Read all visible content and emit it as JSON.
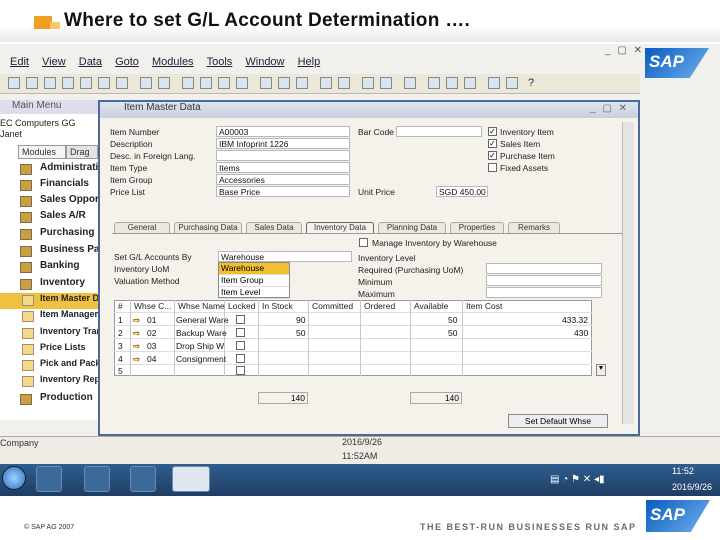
{
  "slide": {
    "title": "Where to set G/L Account Determination ….",
    "copyright": "© SAP AG 2007",
    "tagline": "THE BEST-RUN BUSINESSES RUN SAP",
    "logo_text": "SAP",
    "accent_color": "#f0a020"
  },
  "menubar": [
    "Edit",
    "View",
    "Data",
    "Goto",
    "Modules",
    "Tools",
    "Window",
    "Help"
  ],
  "main_menu": {
    "title": "Main Menu",
    "company": [
      "EC Computers GG",
      "Janet"
    ],
    "tabs": [
      "Modules",
      "Drag"
    ],
    "items": [
      "Administration",
      "Financials",
      "Sales Opportunities",
      "Sales A/R",
      "Purchasing",
      "Business Partners",
      "Banking",
      "Inventory"
    ],
    "sub_items": [
      "Item Master Data",
      "Item Management",
      "Inventory Transactions",
      "Price Lists",
      "Pick and Pack",
      "Inventory Reports",
      "Production"
    ]
  },
  "item_master": {
    "title": "Item Master Data",
    "fields": {
      "item_number_label": "Item Number",
      "item_number": "A00003",
      "description_label": "Description",
      "description": "IBM Infoprint 1226",
      "foreign_label": "Desc. in Foreign Lang.",
      "item_type_label": "Item Type",
      "item_type": "Items",
      "item_group_label": "Item Group",
      "item_group": "Accessories",
      "price_list_label": "Price List",
      "price_list": "Base Price",
      "bar_code_label": "Bar Code",
      "unit_price_label": "Unit Price",
      "unit_price": "SGD 450.00"
    },
    "checkboxes": [
      {
        "label": "Inventory Item",
        "checked": true
      },
      {
        "label": "Sales Item",
        "checked": true
      },
      {
        "label": "Purchase Item",
        "checked": true
      },
      {
        "label": "Fixed Assets",
        "checked": false
      }
    ],
    "tabs": [
      "General",
      "Purchasing Data",
      "Sales Data",
      "Inventory Data",
      "Planning Data",
      "Properties",
      "Remarks"
    ],
    "active_tab": "Inventory Data",
    "manage_by_wh": "Manage Inventory by Warehouse",
    "set_gl_label": "Set G/L Accounts By",
    "set_gl_value": "Warehouse",
    "uom_label": "Inventory UoM",
    "valuation_label": "Valuation Method",
    "dropdown_options": [
      "Warehouse",
      "Item Group",
      "Item Level"
    ],
    "levels": [
      "Inventory Level",
      "Required (Purchasing UoM)",
      "Minimum",
      "Maximum"
    ],
    "grid_headers": [
      "#",
      "Whse C...",
      "Whse Name",
      "Locked",
      "In Stock",
      "Committed",
      "Ordered",
      "Available",
      "Item Cost"
    ],
    "rows": [
      {
        "n": "1",
        "code": "01",
        "name": "General Ware",
        "stock": "90",
        "available": "50",
        "cost": "433.32"
      },
      {
        "n": "2",
        "code": "02",
        "name": "Backup Ware",
        "stock": "50",
        "available": "50",
        "cost": "430"
      },
      {
        "n": "3",
        "code": "03",
        "name": "Drop Ship W",
        "stock": "",
        "available": "",
        "cost": ""
      },
      {
        "n": "4",
        "code": "04",
        "name": "Consignment",
        "stock": "",
        "available": "",
        "cost": ""
      },
      {
        "n": "5",
        "code": "",
        "name": "",
        "stock": "",
        "available": "",
        "cost": ""
      }
    ],
    "total_stock": "140",
    "total_available": "140",
    "set_default_button": "Set Default Whse"
  },
  "status": {
    "left": "Company",
    "date": "2016/9/26",
    "time": "11:52AM"
  },
  "taskbar": {
    "clock_time": "11:52",
    "clock_date": "2016/9/26"
  }
}
